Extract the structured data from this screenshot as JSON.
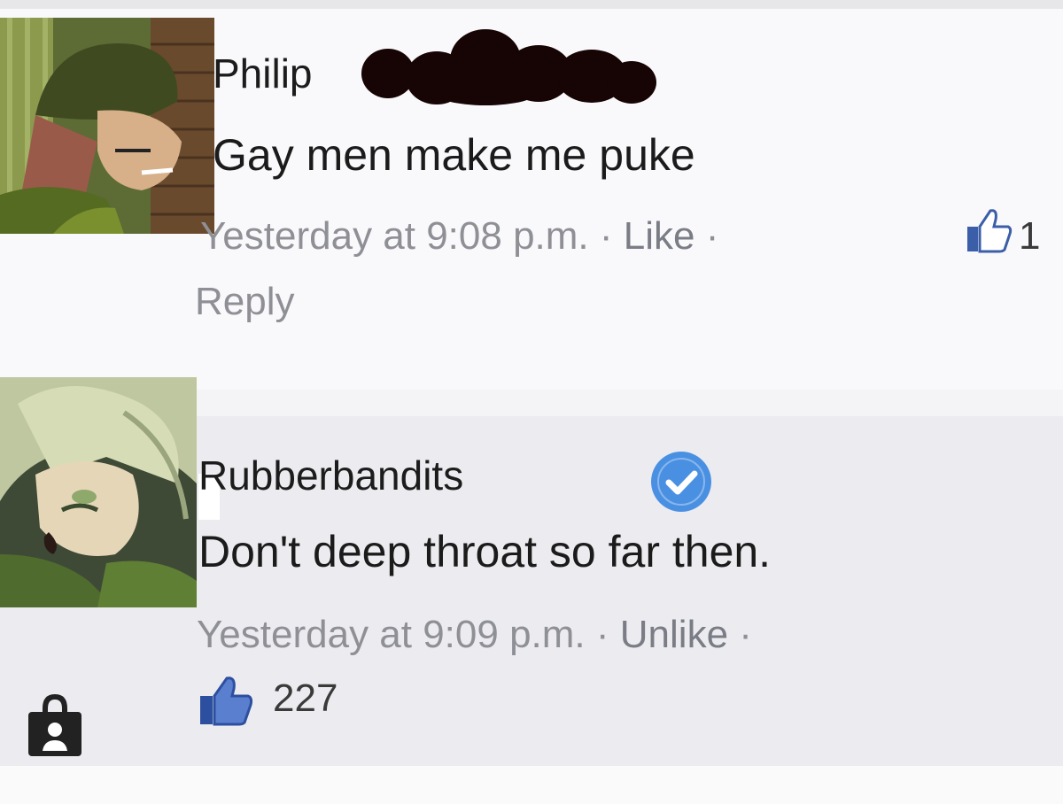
{
  "comments": [
    {
      "author": "Philip",
      "text": "Gay men make me puke",
      "timestamp": "Yesterday at 9:08 p.m.",
      "separator": "·",
      "action": "Like",
      "like_count": "1",
      "reply_label": "Reply",
      "avatar_icon": "anime-character-avatar",
      "name_redacted": true
    },
    {
      "author": "Rubberbandits",
      "verified": true,
      "text": "Don't deep throat so far then.",
      "timestamp": "Yesterday at 9:09 p.m.",
      "separator": "·",
      "action": "Unlike",
      "like_count": "227",
      "avatar_icon": "anime-character-avatar"
    }
  ],
  "icons": {
    "like": "thumbs-up-icon",
    "verified": "verified-badge-icon",
    "privacy": "lock-icon"
  },
  "colors": {
    "verified_blue": "#4a90e2",
    "like_blue": "#3b5ea8",
    "meta_gray": "#8f9096",
    "text": "#1b1b1b"
  }
}
